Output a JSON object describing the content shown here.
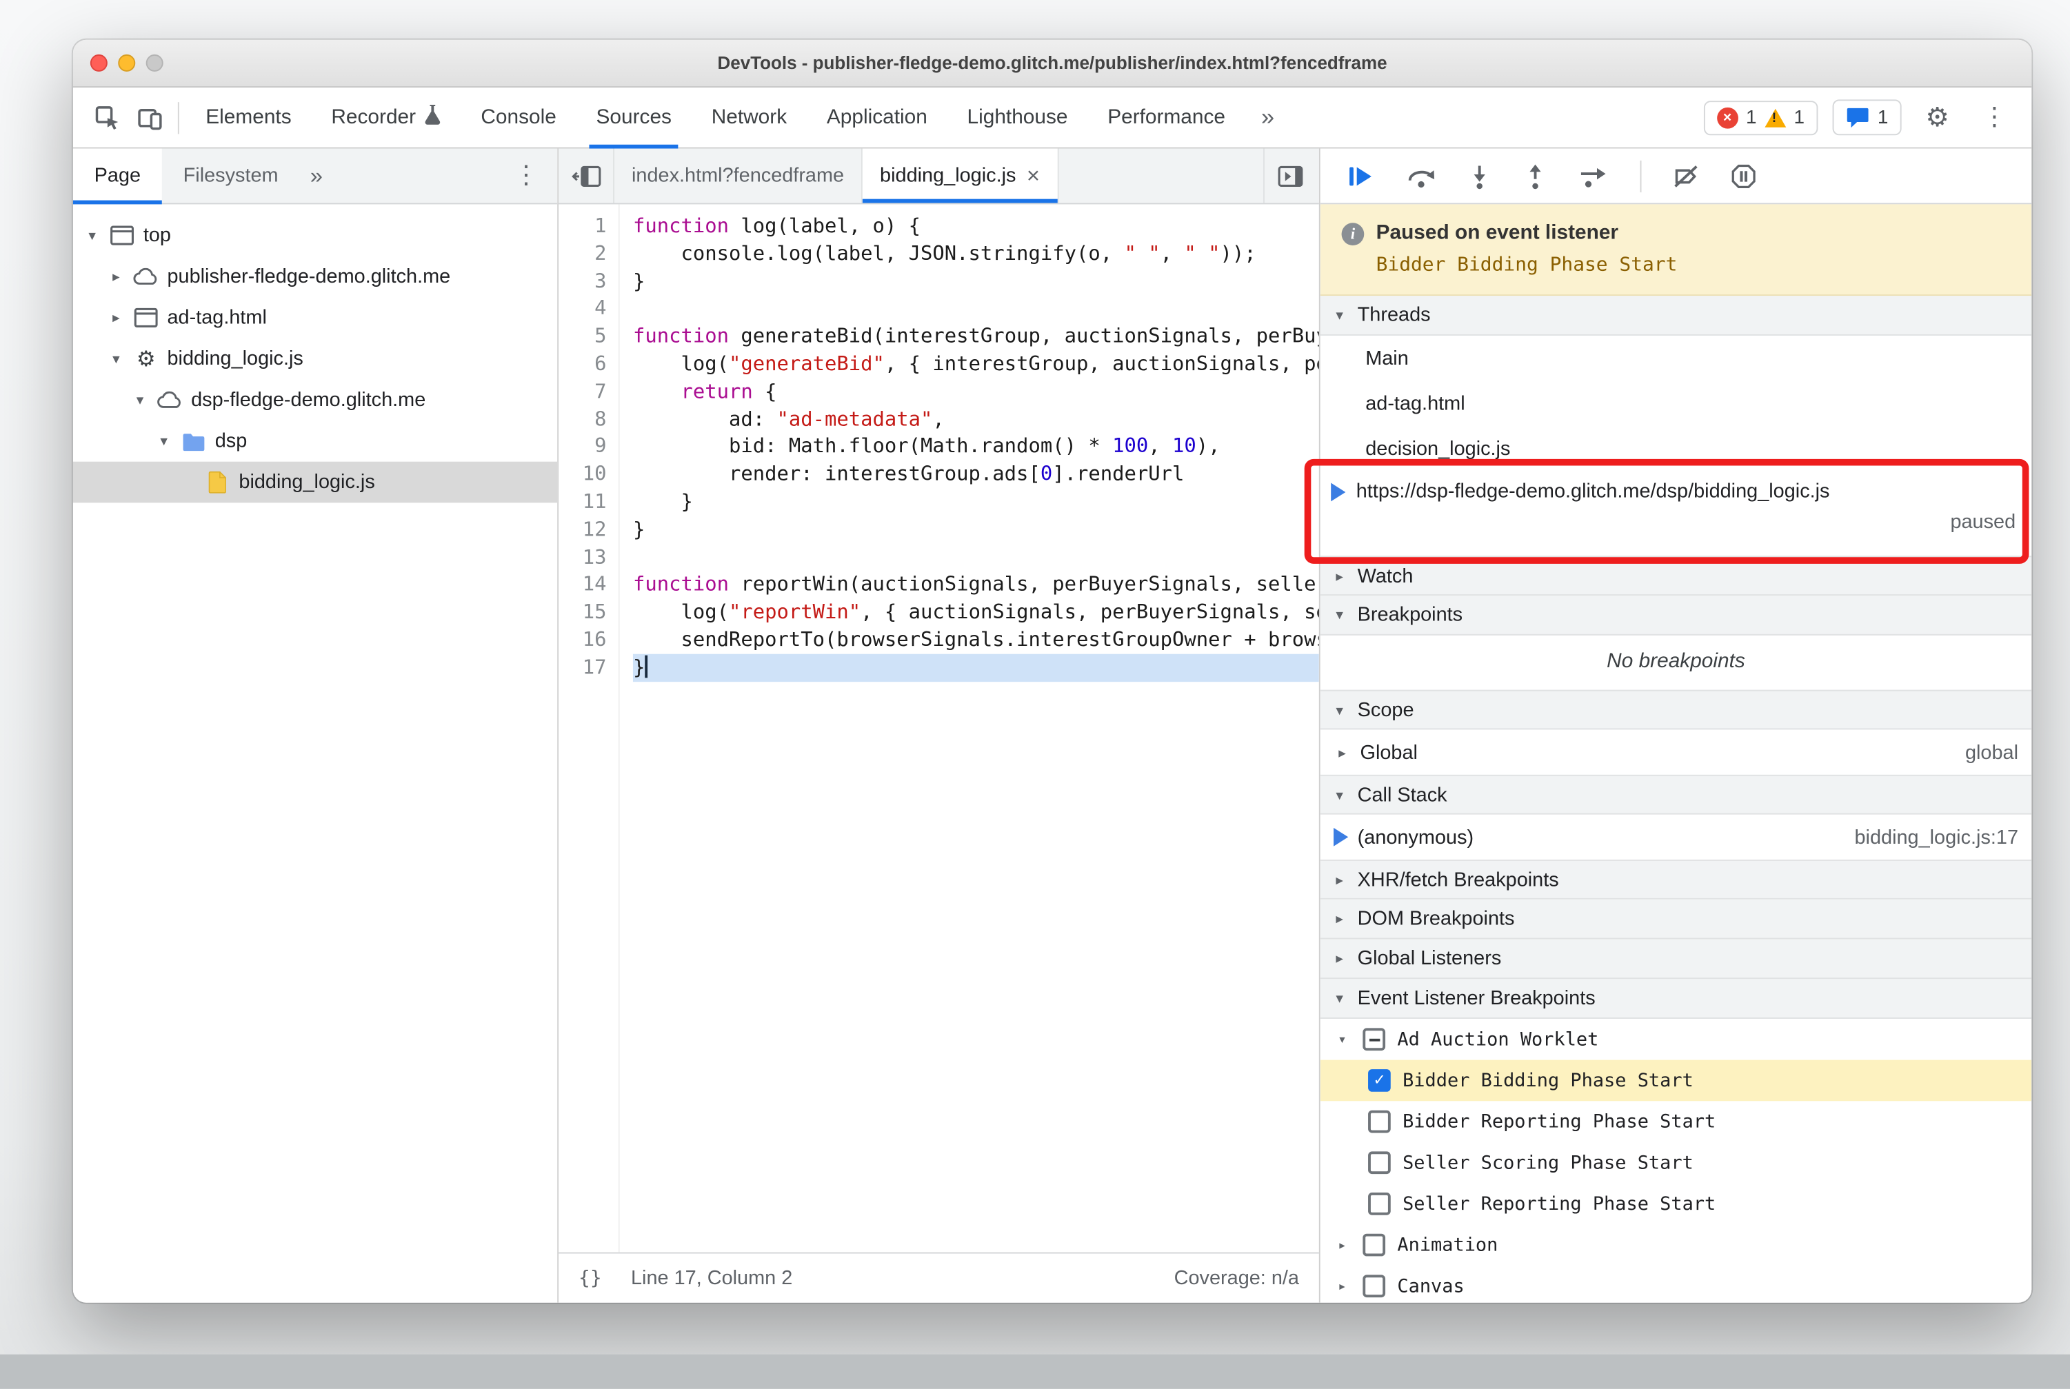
{
  "colors": {
    "accent": "#1a73e8",
    "annotation": "#ee1d1d",
    "banner_bg": "#fbf2d0",
    "banner_detail": "#8a5f00",
    "highlight_row": "#fdf2c0",
    "exec_line": "#cfe2f8",
    "keyword": "#aa0d91",
    "string": "#c41a16",
    "number": "#1c00cf"
  },
  "window": {
    "title": "DevTools - publisher-fledge-demo.glitch.me/publisher/index.html?fencedframe"
  },
  "toolbar": {
    "tabs": [
      {
        "label": "Elements"
      },
      {
        "label": "Recorder",
        "flask": true
      },
      {
        "label": "Console"
      },
      {
        "label": "Sources",
        "selected": true
      },
      {
        "label": "Network"
      },
      {
        "label": "Application"
      },
      {
        "label": "Lighthouse"
      },
      {
        "label": "Performance"
      }
    ],
    "more_symbol": "»",
    "error_count": "1",
    "warning_count": "1",
    "issues_count": "1"
  },
  "navigator": {
    "tabs": {
      "page": "Page",
      "filesystem": "Filesystem",
      "more": "»"
    },
    "tree": [
      {
        "label": "top",
        "icon": "frame",
        "expander": "open",
        "level": 0
      },
      {
        "label": "publisher-fledge-demo.glitch.me",
        "icon": "cloud",
        "expander": "closed",
        "level": 1
      },
      {
        "label": "ad-tag.html",
        "icon": "frame",
        "expander": "closed",
        "level": 1
      },
      {
        "label": "bidding_logic.js",
        "icon": "worklet",
        "expander": "open",
        "level": 1
      },
      {
        "label": "dsp-fledge-demo.glitch.me",
        "icon": "cloud",
        "expander": "open",
        "level": 2
      },
      {
        "label": "dsp",
        "icon": "folder",
        "expander": "open",
        "level": 3
      },
      {
        "label": "bidding_logic.js",
        "icon": "file-js",
        "expander": "none",
        "level": 4,
        "selected": true
      }
    ]
  },
  "editor": {
    "tabs": [
      {
        "label": "index.html?fencedframe"
      },
      {
        "label": "bidding_logic.js",
        "active": true,
        "close": true
      }
    ],
    "current_line": 17,
    "lines": [
      [
        [
          "k",
          "function"
        ],
        [
          "p",
          " log(label, o) {"
        ]
      ],
      [
        [
          "p",
          "    console.log(label, JSON.stringify(o, "
        ],
        [
          "s",
          "\" \""
        ],
        [
          "p",
          ", "
        ],
        [
          "s",
          "\" \""
        ],
        [
          "p",
          "));"
        ]
      ],
      [
        [
          "p",
          "}"
        ]
      ],
      [],
      [
        [
          "k",
          "function"
        ],
        [
          "p",
          " generateBid(interestGroup, auctionSignals, perBuyerSignals) {"
        ]
      ],
      [
        [
          "p",
          "    log("
        ],
        [
          "s",
          "\"generateBid\""
        ],
        [
          "p",
          ", { interestGroup, auctionSignals, perBuyerSignals });"
        ]
      ],
      [
        [
          "p",
          "    "
        ],
        [
          "k",
          "return"
        ],
        [
          "p",
          " {"
        ]
      ],
      [
        [
          "p",
          "        ad: "
        ],
        [
          "s",
          "\"ad-metadata\""
        ],
        [
          "p",
          ","
        ]
      ],
      [
        [
          "p",
          "        bid: Math.floor(Math.random() * "
        ],
        [
          "n",
          "100"
        ],
        [
          "p",
          ", "
        ],
        [
          "n",
          "10"
        ],
        [
          "p",
          "),"
        ]
      ],
      [
        [
          "p",
          "        render: interestGroup.ads["
        ],
        [
          "n",
          "0"
        ],
        [
          "p",
          "].renderUrl"
        ]
      ],
      [
        [
          "p",
          "    }"
        ]
      ],
      [
        [
          "p",
          "}"
        ]
      ],
      [],
      [
        [
          "k",
          "function"
        ],
        [
          "p",
          " reportWin(auctionSignals, perBuyerSignals, sellerSignals, browserSignals) {"
        ]
      ],
      [
        [
          "p",
          "    log("
        ],
        [
          "s",
          "\"reportWin\""
        ],
        [
          "p",
          ", { auctionSignals, perBuyerSignals, sellerSignals });"
        ]
      ],
      [
        [
          "p",
          "    sendReportTo(browserSignals.interestGroupOwner + browserSignals.renderUrl);"
        ]
      ],
      [
        [
          "p",
          "}"
        ]
      ]
    ],
    "status": {
      "braces": "{}",
      "line_col": "Line 17, Column 2",
      "coverage": "Coverage: n/a"
    }
  },
  "debugger": {
    "banner": {
      "title": "Paused on event listener",
      "detail": "Bidder Bidding Phase Start"
    },
    "sections": {
      "threads": "Threads",
      "watch": "Watch",
      "breakpoints": "Breakpoints",
      "scope": "Scope",
      "call_stack": "Call Stack",
      "xhr": "XHR/fetch Breakpoints",
      "dom": "DOM Breakpoints",
      "global_listeners": "Global Listeners",
      "event_listener": "Event Listener Breakpoints"
    },
    "threads": [
      {
        "label": "Main"
      },
      {
        "label": "ad-tag.html"
      },
      {
        "label": "decision_logic.js"
      },
      {
        "label": "https://dsp-fledge-demo.glitch.me/dsp/bidding_logic.js",
        "status": "paused",
        "current": true
      }
    ],
    "breakpoints_empty": "No breakpoints",
    "scope_row": {
      "label": "Global",
      "value": "global"
    },
    "call_stack_frame": {
      "label": "(anonymous)",
      "location": "bidding_logic.js:17"
    },
    "event_listener_groups": [
      {
        "label": "Ad Auction Worklet",
        "checkbox": "indeterminate",
        "expanded": true,
        "children": [
          {
            "label": "Bidder Bidding Phase Start",
            "checked": true,
            "highlighted": true
          },
          {
            "label": "Bidder Reporting Phase Start",
            "checked": false
          },
          {
            "label": "Seller Scoring Phase Start",
            "checked": false
          },
          {
            "label": "Seller Reporting Phase Start",
            "checked": false
          }
        ]
      },
      {
        "label": "Animation",
        "checkbox": "unchecked",
        "expanded": false,
        "children": []
      },
      {
        "label": "Canvas",
        "checkbox": "unchecked",
        "expanded": false,
        "children": []
      }
    ]
  }
}
